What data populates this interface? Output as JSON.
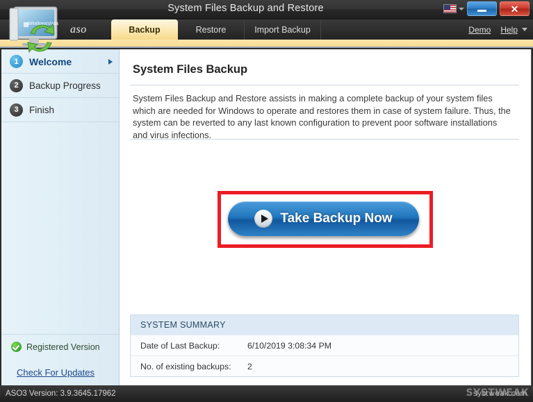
{
  "window": {
    "title": "System Files Backup and Restore",
    "minimize_label": "–",
    "close_label": "✕",
    "language_icon": "us-flag-icon"
  },
  "tabbar": {
    "brand": "aso",
    "tabs": [
      {
        "label": "Backup",
        "active": true
      },
      {
        "label": "Restore",
        "active": false
      },
      {
        "label": "Import Backup",
        "active": false
      }
    ],
    "demo_label": "Demo",
    "help_label": "Help"
  },
  "sidebar": {
    "steps": [
      {
        "number": "1",
        "label": "Welcome",
        "active": true
      },
      {
        "number": "2",
        "label": "Backup Progress",
        "active": false
      },
      {
        "number": "3",
        "label": "Finish",
        "active": false
      }
    ],
    "registered_label": "Registered Version",
    "check_updates_label": "Check For Updates"
  },
  "main": {
    "title": "System Files Backup",
    "description": "System Files Backup and Restore assists in making a complete backup of your system files which are needed for Windows to operate and restores them in case of system failure. Thus, the system can be reverted to any last known configuration to prevent poor software installations and virus infections.",
    "action_button_label": "Take Backup Now"
  },
  "summary": {
    "heading": "SYSTEM SUMMARY",
    "rows": [
      {
        "key": "Date of Last Backup:",
        "value": "6/10/2019 3:08:34 PM"
      },
      {
        "key": "No. of existing backups:",
        "value": "2"
      }
    ]
  },
  "statusbar": {
    "version_text": "ASO3 Version: 3.9.3645.17962",
    "watermark": "SYSTWEAK",
    "watermark_sub": "systweak.com"
  },
  "colors": {
    "accent_blue": "#2176bd",
    "highlight_red": "#ec1c24",
    "tab_active": "#fbe9b4",
    "sidebar_bg": "#dfeef6",
    "registered_green": "#1f8a1f"
  }
}
